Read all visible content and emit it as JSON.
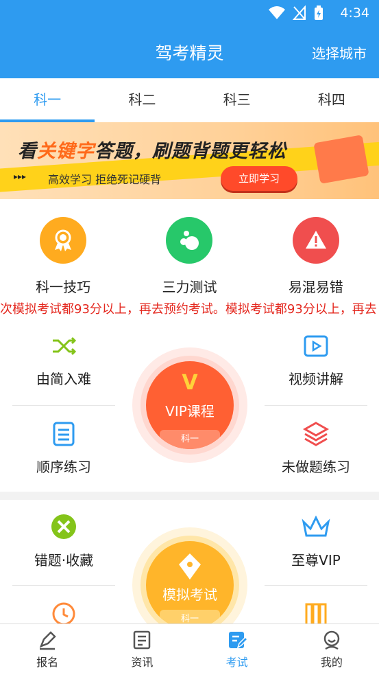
{
  "status": {
    "time": "4:34"
  },
  "header": {
    "title": "驾考精灵",
    "city_button": "选择城市"
  },
  "tabs": [
    {
      "label": "科一",
      "active": true
    },
    {
      "label": "科二",
      "active": false
    },
    {
      "label": "科三",
      "active": false
    },
    {
      "label": "科四",
      "active": false
    }
  ],
  "banner": {
    "headline_prefix": "看",
    "headline_highlight": "关键字",
    "headline_rest": "答题，刷题背题更轻松",
    "tagline": "高效学习  拒绝死记硬背",
    "cta": "立即学习"
  },
  "quick_items": [
    {
      "label": "科一技巧",
      "color": "#ffab1f",
      "icon": "medal-icon"
    },
    {
      "label": "三力测试",
      "color": "#27c86a",
      "icon": "bubbles-icon"
    },
    {
      "label": "易混易错",
      "color": "#f04e4e",
      "icon": "warning-icon"
    }
  ],
  "notice": "次模拟考试都93分以上，再去预约考试。模拟考试都93分以上，再去",
  "practice": {
    "easy_to_hard": "由简入难",
    "video": "视频讲解",
    "sequential": "顺序练习",
    "undone": "未做题练习",
    "vip": {
      "badge": "V",
      "title": "VIP课程",
      "subject": "科一"
    }
  },
  "exam": {
    "wrong_fav": "错题·收藏",
    "supreme_vip": "至尊VIP",
    "mock": {
      "title": "模拟考试",
      "subject": "科一"
    }
  },
  "bottom_nav": [
    {
      "label": "报名",
      "icon": "pen-icon",
      "active": false
    },
    {
      "label": "资讯",
      "icon": "news-icon",
      "active": false
    },
    {
      "label": "考试",
      "icon": "exam-icon",
      "active": true
    },
    {
      "label": "我的",
      "icon": "profile-icon",
      "active": false
    }
  ],
  "colors": {
    "primary": "#2e9bf0",
    "notice": "#e4281f",
    "vip": "#ff6033",
    "mock": "#ffb52a"
  }
}
